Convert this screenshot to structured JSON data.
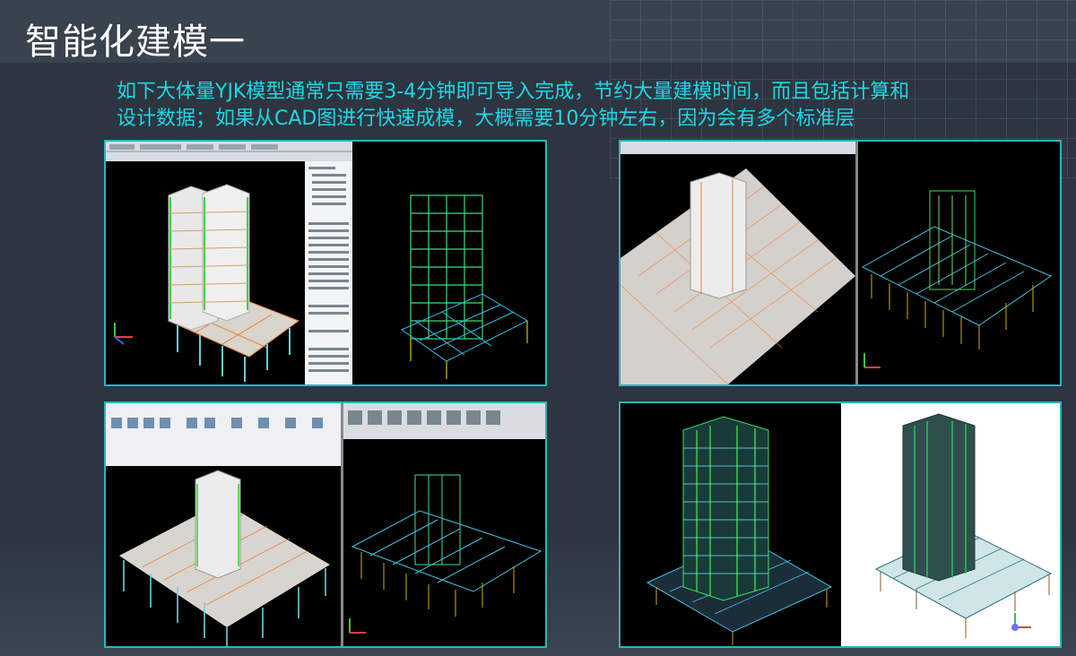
{
  "slide": {
    "title": "智能化建模一",
    "description_line1": "如下大体量YJK模型通常只需要3-4分钟即可导入完成，节约大量建模时间，而且包括计算和",
    "description_line2": "设计数据；如果从CAD图进行快速成模，大概需要10分钟左右，因为会有多个标准层"
  },
  "colors": {
    "accent_cyan": "#1fd6e4",
    "panel_border": "#25b7bd",
    "background": "#2c3540"
  }
}
